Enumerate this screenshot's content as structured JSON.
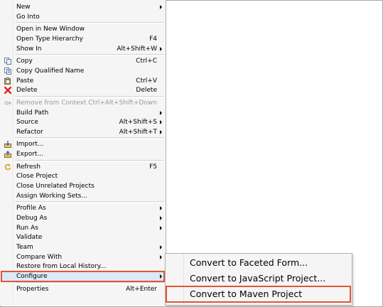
{
  "menu": {
    "groups": [
      [
        {
          "label": "New",
          "arrow": true
        },
        {
          "label": "Go Into"
        }
      ],
      [
        {
          "label": "Open in New Window"
        },
        {
          "label": "Open Type Hierarchy",
          "shortcut": "F4"
        },
        {
          "label": "Show In",
          "shortcut": "Alt+Shift+W",
          "arrow": true
        }
      ],
      [
        {
          "label": "Copy",
          "shortcut": "Ctrl+C",
          "icon": "copy-icon"
        },
        {
          "label": "Copy Qualified Name",
          "icon": "copy-qualified-name-icon"
        },
        {
          "label": "Paste",
          "shortcut": "Ctrl+V",
          "icon": "paste-icon"
        },
        {
          "label": "Delete",
          "shortcut": "Delete",
          "icon": "delete-icon"
        }
      ],
      [
        {
          "label": "Remove from Context",
          "shortcut": "Ctrl+Alt+Shift+Down",
          "icon": "remove-from-context-icon",
          "disabled": true
        },
        {
          "label": "Build Path",
          "arrow": true
        },
        {
          "label": "Source",
          "shortcut": "Alt+Shift+S",
          "arrow": true
        },
        {
          "label": "Refactor",
          "shortcut": "Alt+Shift+T",
          "arrow": true
        }
      ],
      [
        {
          "label": "Import...",
          "icon": "import-icon"
        },
        {
          "label": "Export...",
          "icon": "export-icon"
        }
      ],
      [
        {
          "label": "Refresh",
          "shortcut": "F5",
          "icon": "refresh-icon"
        },
        {
          "label": "Close Project"
        },
        {
          "label": "Close Unrelated Projects"
        },
        {
          "label": "Assign Working Sets..."
        }
      ],
      [
        {
          "label": "Profile As",
          "arrow": true
        },
        {
          "label": "Debug As",
          "arrow": true
        },
        {
          "label": "Run As",
          "arrow": true
        },
        {
          "label": "Validate"
        },
        {
          "label": "Team",
          "arrow": true
        },
        {
          "label": "Compare With",
          "arrow": true
        },
        {
          "label": "Restore from Local History..."
        },
        {
          "label": "Configure",
          "arrow": true,
          "highlighted": true
        }
      ],
      [
        {
          "label": "Properties",
          "shortcut": "Alt+Enter"
        }
      ]
    ]
  },
  "submenu": {
    "items": [
      {
        "label": "Convert to Faceted Form..."
      },
      {
        "label": "Convert to JavaScript Project..."
      },
      {
        "label": "Convert to Maven Project",
        "highlighted": true
      }
    ]
  },
  "colors": {
    "highlight_box": "#e0553a",
    "menu_background": "#f5f5f5",
    "selection_background": "#dce9f7"
  }
}
